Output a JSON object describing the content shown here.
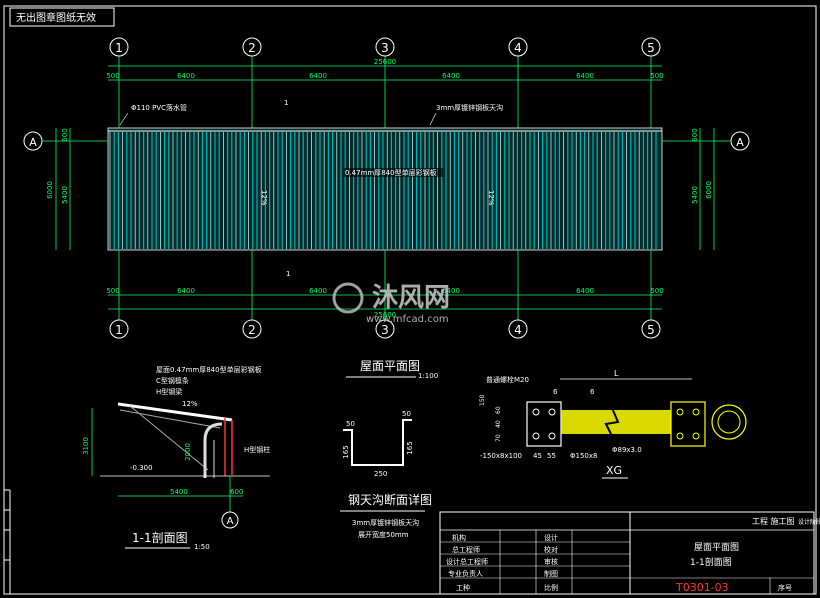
{
  "stamp": "无出图章图纸无效",
  "grid_marks": [
    "1",
    "2",
    "3",
    "4",
    "5"
  ],
  "row_mark": "A",
  "top_dims": {
    "total": "25600",
    "edge_left": "500",
    "bay": "6400",
    "edge_right": "500"
  },
  "side_dims": {
    "overall": "6000",
    "inner": "5400",
    "edge": "600"
  },
  "plan_callouts": {
    "pvc": "Φ110 PVC落水管",
    "gutter": "3mm厚镀锌钢板天沟",
    "roof": "0.47mm厚840型单层彩钢板",
    "slope": "12%",
    "sec_mark": "1"
  },
  "plan_title": "屋面平面图",
  "plan_scale": "1:100",
  "section": {
    "note1": "屋面0.47mm厚840型单层彩钢板",
    "note2": "C型钢檩条",
    "note3": "H型钢梁",
    "slope": "12%",
    "col_label": "H型钢柱",
    "ground": "-0.300",
    "height": "3100",
    "h2": "2000",
    "w1": "5400",
    "w2": "600",
    "title": "1-1剖面图",
    "scale": "1:50"
  },
  "gutter_detail": {
    "title": "钢天沟断面详图",
    "d1": "50",
    "d2": "165",
    "d3": "250",
    "note1": "3mm厚镀锌钢板天沟",
    "note2": "展开宽度50mm"
  },
  "xg_detail": {
    "anchor": "普通螺栓M20",
    "plate": "6",
    "len": "L",
    "pipe": "Φ89x3.0",
    "plate2": "-150x8x100",
    "w1": "45",
    "w2": "55",
    "hole": "Φ150x8",
    "tag": "XG",
    "dims": [
      "150",
      "60",
      "40",
      "70"
    ]
  },
  "title_block": {
    "header": "工程  施工图",
    "stage": "设计阶段",
    "rows_left": [
      "机构",
      "总工程师",
      "设计总工程师",
      "专业负责人",
      "工种"
    ],
    "rows_mid": [
      "设计",
      "校对",
      "审核",
      "制图",
      "比例"
    ],
    "drawing_name_1": "屋面平面图",
    "drawing_name_2": "1-1剖面图",
    "drawing_no": "T0301-03",
    "sheet": "序号"
  },
  "watermark": {
    "brand": "沐风网",
    "url": "www.mfcad.com"
  },
  "colors": {
    "background": "#000000",
    "roof": "#00b3b3",
    "dims": "#00ff66",
    "detail": "#ffff00"
  }
}
